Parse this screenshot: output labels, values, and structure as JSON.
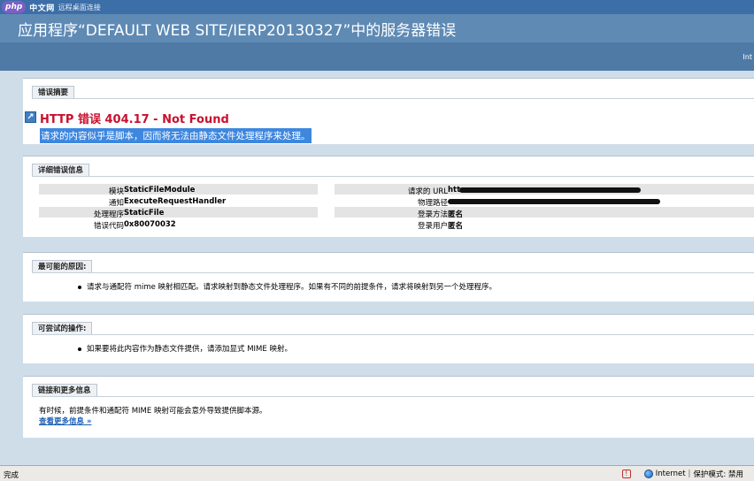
{
  "watermark": {
    "logo": "php",
    "site": "中文网",
    "rest": "远程桌面连接"
  },
  "page": {
    "title": "应用程序“DEFAULT WEB SITE/IERP20130327”中的服务器错误"
  },
  "subbar": {
    "text": "Int"
  },
  "summary": {
    "label": "错误摘要",
    "heading": "HTTP 错误 404.17 - Not Found",
    "description": "请求的内容似乎是脚本，因而将无法由静态文件处理程序来处理。"
  },
  "details": {
    "label": "详细错误信息",
    "left": [
      {
        "key": "模块",
        "value": "StaticFileModule"
      },
      {
        "key": "通知",
        "value": "ExecuteRequestHandler"
      },
      {
        "key": "处理程序",
        "value": "StaticFile"
      },
      {
        "key": "错误代码",
        "value": "0x80070032"
      }
    ],
    "right": [
      {
        "key": "请求的 URL",
        "value": "htt"
      },
      {
        "key": "物理路径",
        "value": ""
      },
      {
        "key": "登录方法",
        "value": "匿名"
      },
      {
        "key": "登录用户",
        "value": "匿名"
      }
    ]
  },
  "causes": {
    "label": "最可能的原因:",
    "items": [
      "请求与通配符 mime 映射相匹配。请求映射到静态文件处理程序。如果有不同的前提条件，请求将映射到另一个处理程序。"
    ]
  },
  "actions": {
    "label": "可尝试的操作:",
    "items": [
      "如果要将此内容作为静态文件提供，请添加显式 MIME 映射。"
    ]
  },
  "links": {
    "label": "链接和更多信息",
    "text": "有时候，前提条件和通配符 MIME 映射可能会意外导致提供脚本源。",
    "more": "查看更多信息 »"
  },
  "status": {
    "left": "完成",
    "zone": "Internet",
    "separator": "|",
    "protected_mode": "保护模式: 禁用"
  }
}
